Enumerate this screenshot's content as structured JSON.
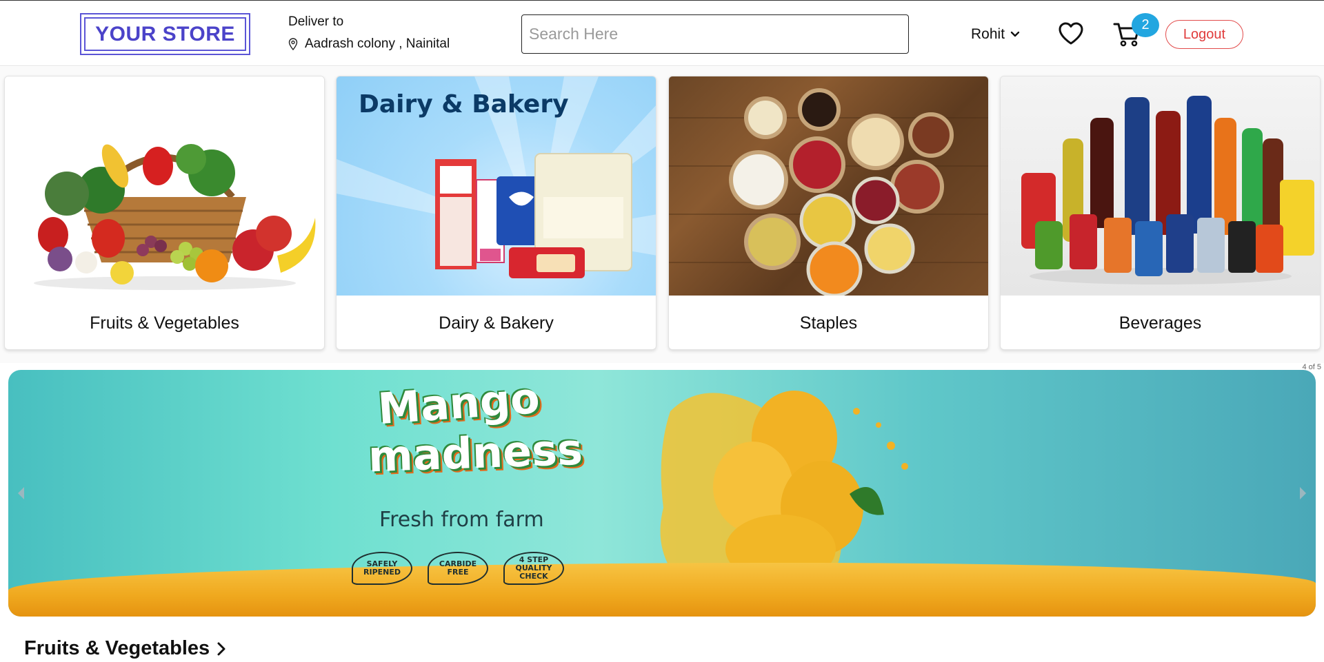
{
  "header": {
    "logo_text": "YOUR STORE",
    "deliver_label": "Deliver to",
    "deliver_address": "Aadrash colony , Nainital",
    "search_placeholder": "Search Here",
    "user_name": "Rohit",
    "cart_count": "2",
    "logout_label": "Logout"
  },
  "categories": [
    {
      "label": "Fruits & Vegetables",
      "icon": "fruit-basket-image"
    },
    {
      "label": "Dairy & Bakery",
      "icon": "dairy-products-image"
    },
    {
      "label": "Staples",
      "icon": "pulses-bowls-image"
    },
    {
      "label": "Beverages",
      "icon": "soft-drinks-image"
    }
  ],
  "dairy_banner_title": "Dairy & Bakery",
  "banner": {
    "title_line1": "Mango",
    "title_line2": "madness",
    "subtitle": "Fresh from farm",
    "features": [
      "SAFELY RIPENED",
      "CARBIDE FREE",
      "4 STEP QUALITY CHECK"
    ],
    "counter": "4 of 5"
  },
  "section": {
    "title": "Fruits & Vegetables"
  },
  "colors": {
    "brand": "#4b43c9",
    "badge": "#22a6e0",
    "logout": "#e03b3b"
  }
}
